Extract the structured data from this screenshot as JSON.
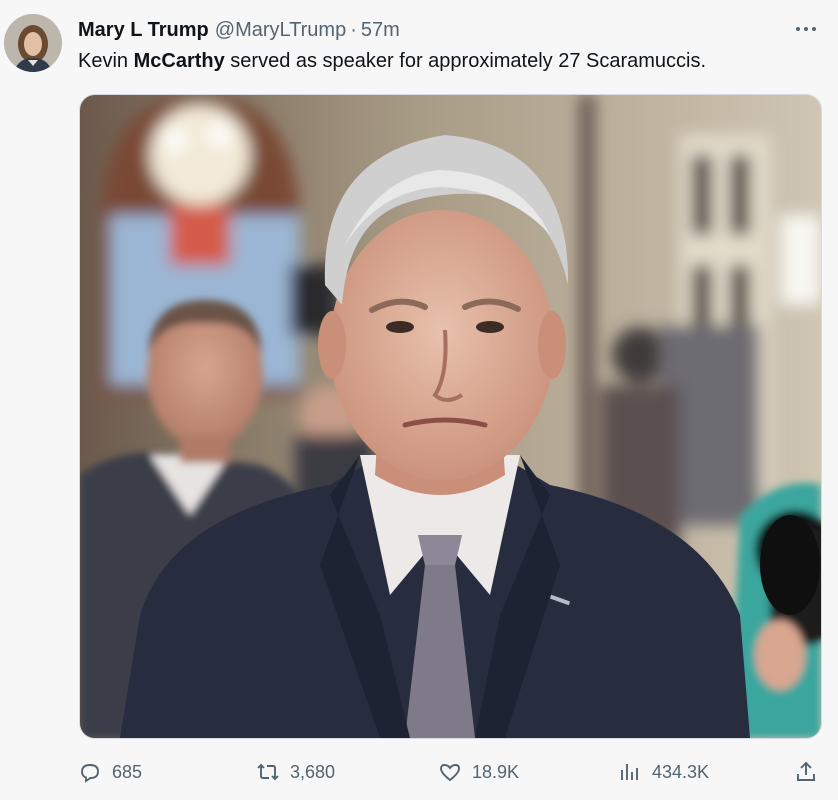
{
  "tweet": {
    "author_name": "Mary L Trump",
    "author_handle": "@MaryLTrump",
    "separator": "·",
    "time": "57m",
    "text_before": "Kevin ",
    "text_bold": "McCarthy",
    "text_after": " served as speaker for approximately 27 Scaramuccis."
  },
  "actions": {
    "replies": "685",
    "retweets": "3,680",
    "likes": "18.9K",
    "views": "434.3K"
  },
  "icons": {
    "more": "more-horizontal-icon",
    "reply": "reply-icon",
    "retweet": "retweet-icon",
    "like": "heart-icon",
    "views": "views-chart-icon",
    "share": "share-icon"
  },
  "colors": {
    "background": "#f7f7f7",
    "text_primary": "#0f1419",
    "text_secondary": "#536471"
  }
}
